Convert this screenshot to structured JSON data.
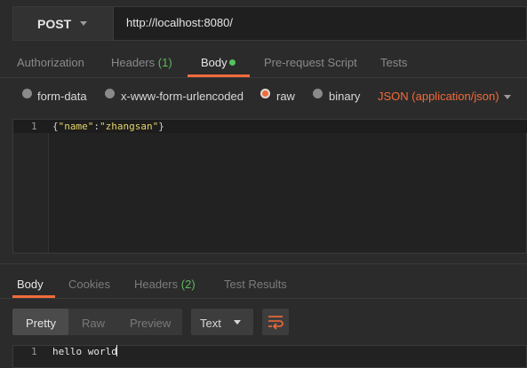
{
  "request": {
    "method": "POST",
    "url": "http://localhost:8080/"
  },
  "request_tabs": [
    {
      "label": "Authorization"
    },
    {
      "label": "Headers",
      "count": "(1)"
    },
    {
      "label": "Body"
    },
    {
      "label": "Pre-request Script"
    },
    {
      "label": "Tests"
    }
  ],
  "body_options": {
    "form_data": "form-data",
    "urlencoded": "x-www-form-urlencoded",
    "raw": "raw",
    "binary": "binary",
    "selected": "raw",
    "content_type": "JSON (application/json)"
  },
  "editor": {
    "line_number": "1",
    "code_open": "{",
    "code_key": "\"name\"",
    "code_colon": ":",
    "code_value": "\"zhangsan\"",
    "code_close": "}"
  },
  "response_tabs": [
    {
      "label": "Body"
    },
    {
      "label": "Cookies"
    },
    {
      "label": "Headers",
      "count": "(2)"
    },
    {
      "label": "Test Results"
    }
  ],
  "response_view": {
    "pretty": "Pretty",
    "raw": "Raw",
    "preview": "Preview",
    "format": "Text"
  },
  "response_body": {
    "line_number": "1",
    "text": "hello world"
  },
  "colors": {
    "accent": "#f26b3a",
    "count_green": "#5fb95f",
    "dot_green": "#53c35c"
  }
}
